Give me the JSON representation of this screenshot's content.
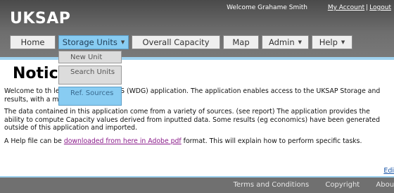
{
  "header": {
    "app_title": "UKSAP",
    "welcome": "Welcome Grahame Smith",
    "my_account": "My Account",
    "separator": "|",
    "logout": "Logout"
  },
  "nav": {
    "tabs": [
      {
        "label": "Home",
        "has_caret": false
      },
      {
        "label": "Storage Units",
        "has_caret": true,
        "active": true
      },
      {
        "label": "Overall Capacity",
        "has_caret": false
      },
      {
        "label": "Map",
        "has_caret": false
      },
      {
        "label": "Admin",
        "has_caret": true
      },
      {
        "label": "Help",
        "has_caret": true
      }
    ],
    "caret_icon": "▼"
  },
  "dropdown": {
    "items": [
      {
        "label": "New Unit"
      },
      {
        "label": "Search Units"
      },
      {
        "label": "Ref. Sources",
        "hovered": true
      }
    ]
  },
  "main": {
    "title": "Notice",
    "para1": "Welcome to th              led Database and GIS (WDG) application. The application enables access to the UKSAP Storage              and results, with a map search facility.",
    "para2": "The data contained in this application come from a variety of sources. (see report) The application provides the ability to compute Capacity values derived from inputted data. Some results (eg economics) have been generated outside of this application and imported.",
    "para3_before": "A Help file can be ",
    "para3_link": "downloaded from here in Adobe pdf",
    "para3_after": " format. This will explain how to perform specific tasks.",
    "edit_link": "Edi"
  },
  "footer": {
    "terms": "Terms and Conditions",
    "copyright": "Copyright",
    "about": "About"
  },
  "colors": {
    "header_bg": "#5f5f5f",
    "accent_blue": "#88ccf2",
    "link_visited": "#8a1b8a",
    "footer_bg": "#707070"
  }
}
